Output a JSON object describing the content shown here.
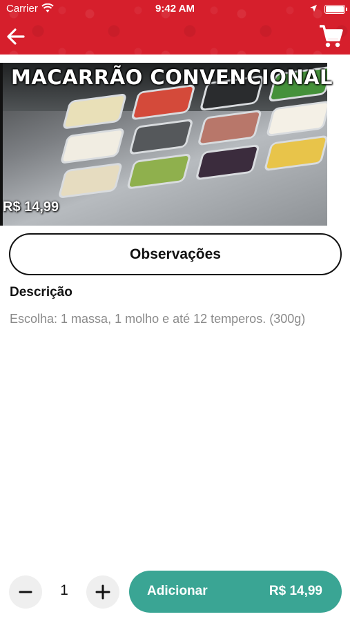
{
  "status_bar": {
    "carrier": "Carrier",
    "time": "9:42 AM"
  },
  "header": {
    "back_icon": "arrow-left-icon",
    "cart_icon": "shopping-cart-icon",
    "bar_color": "#d61f2c"
  },
  "product": {
    "title": "MACARRÃO CONVENCIONAL",
    "price": "R$ 14,99"
  },
  "observations_button": {
    "label": "Observações"
  },
  "description": {
    "heading": "Descrição",
    "text": "Escolha: 1 massa, 1 molho e até 12 temperos. (300g)"
  },
  "footer": {
    "quantity": "1",
    "add_label": "Adicionar",
    "add_price": "R$ 14,99",
    "accent_color": "#3aa594"
  }
}
